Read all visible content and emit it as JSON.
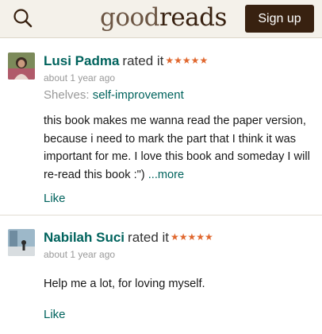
{
  "header": {
    "logo_good": "good",
    "logo_reads": "reads",
    "signup_label": "Sign up",
    "search_icon": "search-icon"
  },
  "colors": {
    "header_bg": "#f4f1ea",
    "brand_dark": "#382110",
    "link_green": "#00635d",
    "star_orange": "#e0672e"
  },
  "reviews": [
    {
      "name": "Lusi Padma",
      "rated_text": "rated it",
      "stars": "★★★★★",
      "rating": 5,
      "date": "about 1 year ago",
      "shelves_label": "Shelves:",
      "shelf": "self-improvement",
      "text": "this book makes me wanna read the paper version, because i need to mark the part that I think it was important for me. I love this book and someday I will re-read this book :\")",
      "more_label": "...more",
      "like_label": "Like"
    },
    {
      "name": "Nabilah Suci",
      "rated_text": "rated it",
      "stars": "★★★★★",
      "rating": 5,
      "date": "about 1 year ago",
      "text": "Help me a lot, for loving myself.",
      "like_label": "Like"
    }
  ]
}
